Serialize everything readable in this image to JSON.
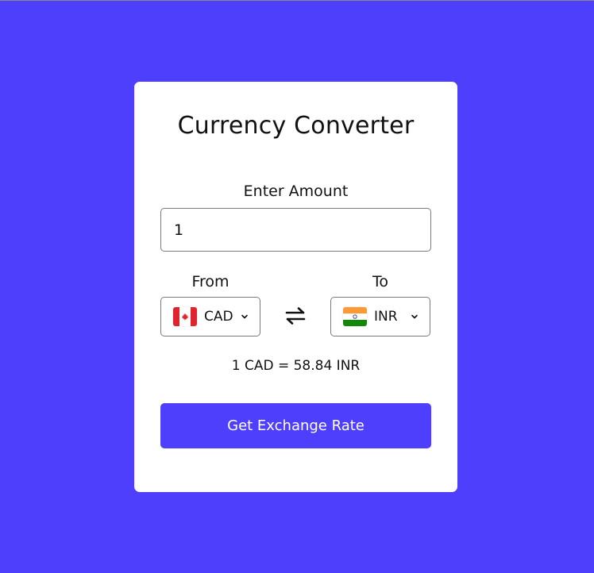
{
  "converter": {
    "title": "Currency Converter",
    "amount_label": "Enter Amount",
    "amount_value": "1",
    "from": {
      "label": "From",
      "currency_code": "CAD",
      "flag_icon": "flag-canada-icon"
    },
    "to": {
      "label": "To",
      "currency_code": "INR",
      "flag_icon": "flag-india-icon"
    },
    "swap_icon": "swap-arrows-icon",
    "rate_text": "1 CAD = 58.84 INR",
    "button_label": "Get Exchange Rate"
  },
  "colors": {
    "background": "#4e3ffc",
    "card": "#ffffff",
    "button": "#4e3ffc",
    "button_text": "#ffffff"
  }
}
